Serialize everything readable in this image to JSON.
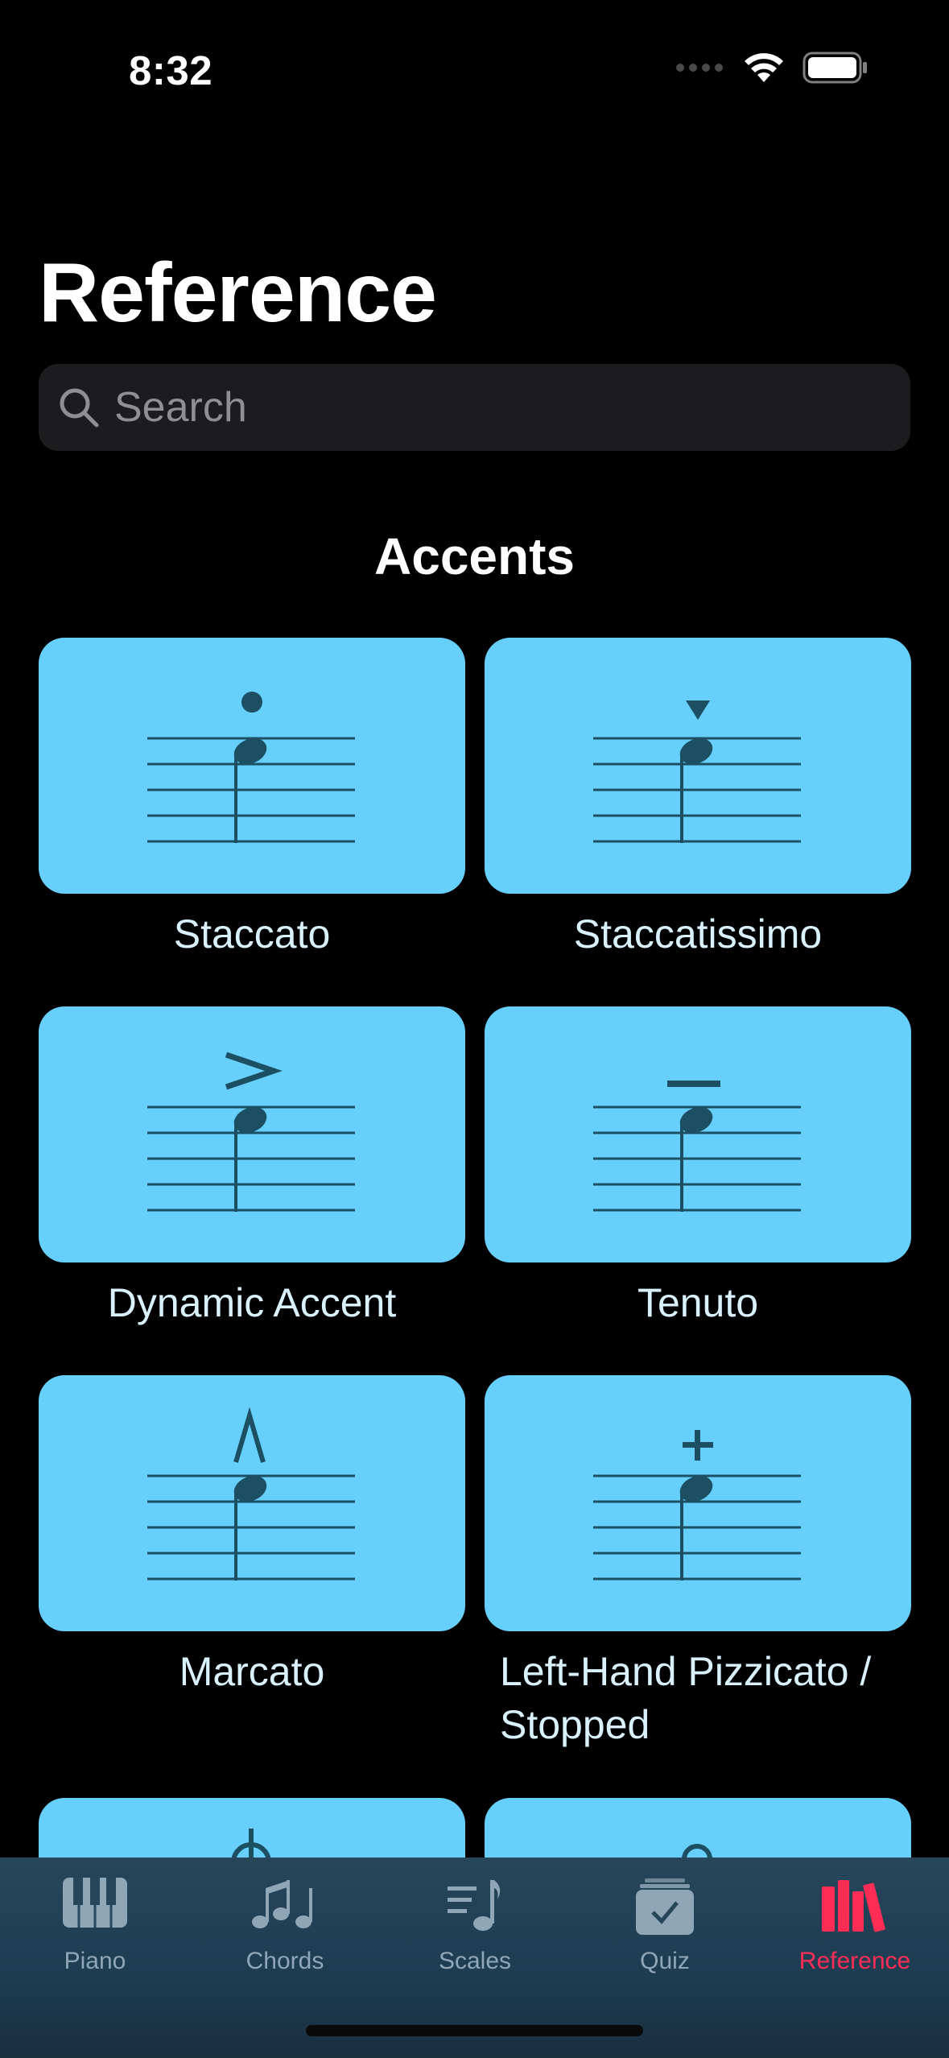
{
  "status_bar": {
    "time": "8:32"
  },
  "header": {
    "title": "Reference"
  },
  "search": {
    "placeholder": "Search"
  },
  "section": {
    "title": "Accents"
  },
  "cards": [
    {
      "label": "Staccato",
      "symbol": "dot"
    },
    {
      "label": "Staccatissimo",
      "symbol": "wedge"
    },
    {
      "label": "Dynamic Accent",
      "symbol": ">"
    },
    {
      "label": "Tenuto",
      "symbol": "–"
    },
    {
      "label": "Marcato",
      "symbol": "Λ"
    },
    {
      "label": "Left-Hand Pizzicato / Stopped",
      "symbol": "+"
    }
  ],
  "tabbar": {
    "items": [
      {
        "label": "Piano",
        "icon": "piano-icon"
      },
      {
        "label": "Chords",
        "icon": "chords-icon"
      },
      {
        "label": "Scales",
        "icon": "scales-icon"
      },
      {
        "label": "Quiz",
        "icon": "quiz-icon"
      },
      {
        "label": "Reference",
        "icon": "reference-icon",
        "active": true
      }
    ]
  },
  "colors": {
    "background": "#000000",
    "card": "#66cffc",
    "notation": "#1d4f63",
    "tab_active": "#ff2d55",
    "tab_inactive": "#8fa6b6",
    "search_bg": "#1c1c1e"
  }
}
